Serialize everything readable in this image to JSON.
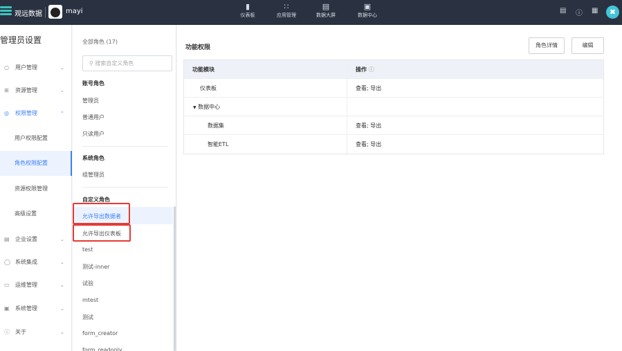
{
  "topbar": {
    "brand": "观远数据",
    "user": "mayi",
    "nav": [
      {
        "label": "仪表板",
        "icon": "dashboard-icon"
      },
      {
        "label": "应用管理",
        "icon": "apps-icon"
      },
      {
        "label": "数据大屏",
        "icon": "screen-icon"
      },
      {
        "label": "数据中心",
        "icon": "data-center-icon"
      }
    ]
  },
  "left_sidebar": {
    "title": "管理员设置",
    "items": [
      {
        "label": "用户管理"
      },
      {
        "label": "资源管理"
      },
      {
        "label": "权限管理"
      },
      {
        "label": "企业设置"
      },
      {
        "label": "系统集成"
      },
      {
        "label": "运维管理"
      },
      {
        "label": "系统管理"
      },
      {
        "label": "关于"
      }
    ],
    "subitems": [
      {
        "label": "用户权限配置"
      },
      {
        "label": "角色权限配置"
      },
      {
        "label": "资源权限管理"
      },
      {
        "label": "高级设置"
      }
    ]
  },
  "roles": {
    "all_label": "全部角色 (17)",
    "search_placeholder": "搜索自定义角色",
    "account_group": "账号角色",
    "account_roles": [
      "管理员",
      "普通用户",
      "只读用户"
    ],
    "system_group": "系统角色",
    "system_roles": [
      "组管理员"
    ],
    "custom_group": "自定义角色",
    "custom_roles": [
      "允许导出数据者",
      "允许导出仪表板",
      "test",
      "测试-inner",
      "试验",
      "mtest",
      "测试",
      "form_creator",
      "form_readonly"
    ]
  },
  "main": {
    "title": "功能权限",
    "detail_button": "角色详情",
    "edit_button": "编辑",
    "columns": [
      "功能模块",
      "操作"
    ],
    "rows": [
      {
        "module": "仪表板",
        "ops": "查看; 导出"
      },
      {
        "module": "数据中心",
        "ops": ""
      },
      {
        "module": "数据集",
        "ops": "查看; 导出"
      },
      {
        "module": "智能ETL",
        "ops": "查看; 导出"
      }
    ]
  },
  "colors": {
    "topbar": "#2a3242",
    "accent": "#3d7ff5",
    "highlight": "#e53935"
  }
}
